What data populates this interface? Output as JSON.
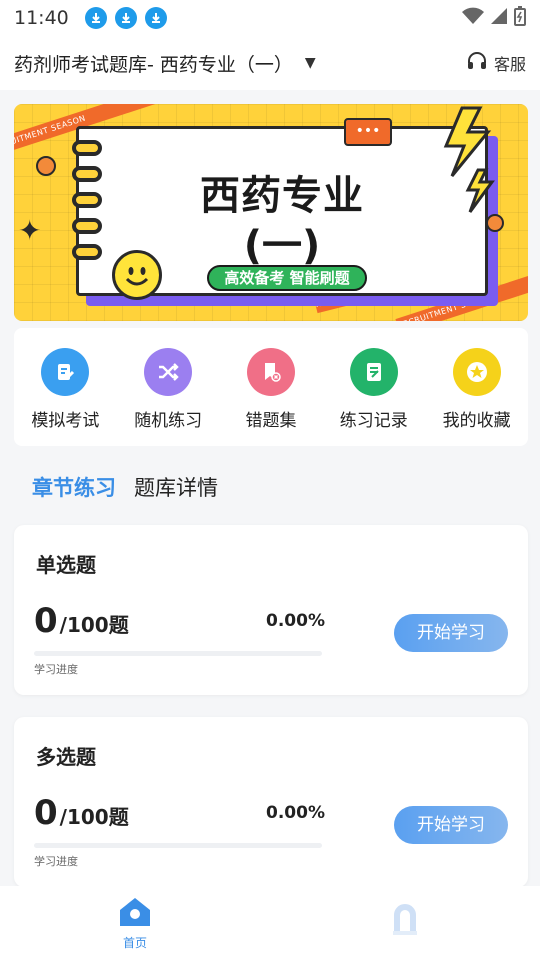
{
  "status_bar": {
    "time": "11:40"
  },
  "header": {
    "title": "药剂师考试题库- 西药专业（一）",
    "service_label": "客服"
  },
  "banner": {
    "title": "西药专业",
    "subtitle": "(一)",
    "tag": "高效备考 智能刷题",
    "tape_text": "RECRUITMENT SEASON",
    "bubble": "•••"
  },
  "quick_menu": [
    {
      "label": "模拟考试",
      "icon": "document-edit-icon",
      "color": "#3a9ff0"
    },
    {
      "label": "随机练习",
      "icon": "shuffle-icon",
      "color": "#9b7ff0"
    },
    {
      "label": "错题集",
      "icon": "bookmark-error-icon",
      "color": "#f06f87"
    },
    {
      "label": "练习记录",
      "icon": "notepad-icon",
      "color": "#23b36a"
    },
    {
      "label": "我的收藏",
      "icon": "star-icon",
      "color": "#f5d21a"
    }
  ],
  "tabs": {
    "active": "章节练习",
    "other": "题库详情"
  },
  "cards": [
    {
      "title": "单选题",
      "done": "0",
      "total": "/100题",
      "percent": "0.00%",
      "progress_label": "学习进度",
      "progress": 0,
      "button": "开始学习"
    },
    {
      "title": "多选题",
      "done": "0",
      "total": "/100题",
      "percent": "0.00%",
      "progress_label": "学习进度",
      "progress": 0,
      "button": "开始学习"
    }
  ],
  "bottom_nav": [
    {
      "label": "首页",
      "icon": "home-icon"
    },
    {
      "label": "",
      "icon": "profile-icon"
    }
  ],
  "colors": {
    "accent": "#3a8ee6",
    "banner_bg": "#ffd23a"
  }
}
